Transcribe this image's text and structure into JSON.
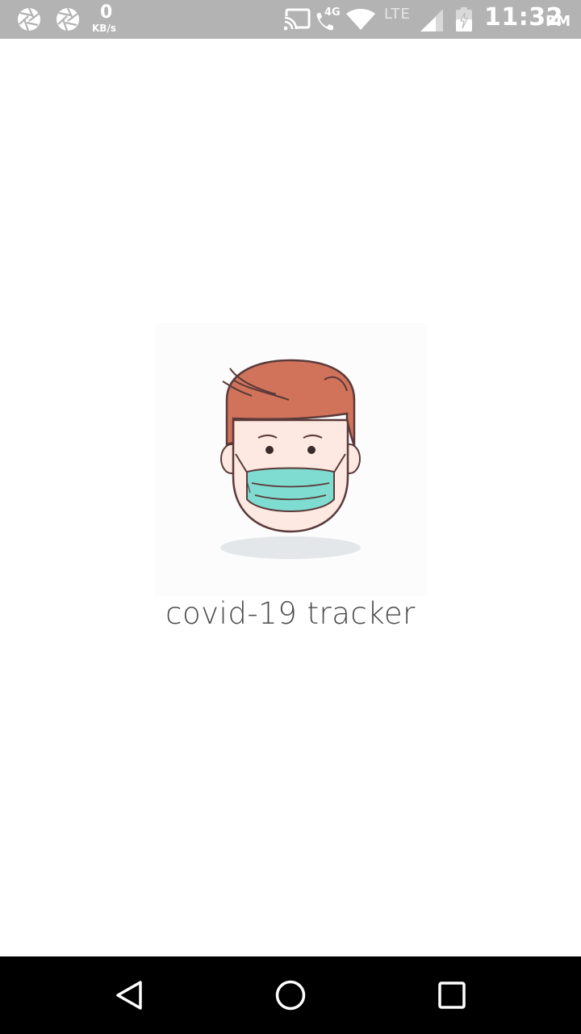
{
  "status_bar": {
    "left_icons": [
      "aperture-icon",
      "aperture-icon"
    ],
    "network_speed_value": "0",
    "network_speed_unit": "KB/s",
    "network_type": "4G",
    "lte_label": "LTE",
    "time": "11:32",
    "ampm": "PM",
    "right_icons": [
      "cast-icon",
      "volte-call-icon",
      "wifi-icon",
      "cell-signal-icon",
      "battery-icon"
    ],
    "background_color": "#b3b3b3"
  },
  "splash": {
    "app_name": "covid-19 tracker",
    "logo_icon": "masked-face-icon",
    "colors": {
      "hair": "#d0735a",
      "skin": "#fde9e1",
      "mask": "#7fdcd0",
      "outline": "#5a3a3a",
      "shadow": "#e3e7e9"
    }
  },
  "nav_bar": {
    "buttons": [
      "back-icon",
      "home-icon",
      "recents-icon"
    ],
    "background_color": "#000000"
  }
}
